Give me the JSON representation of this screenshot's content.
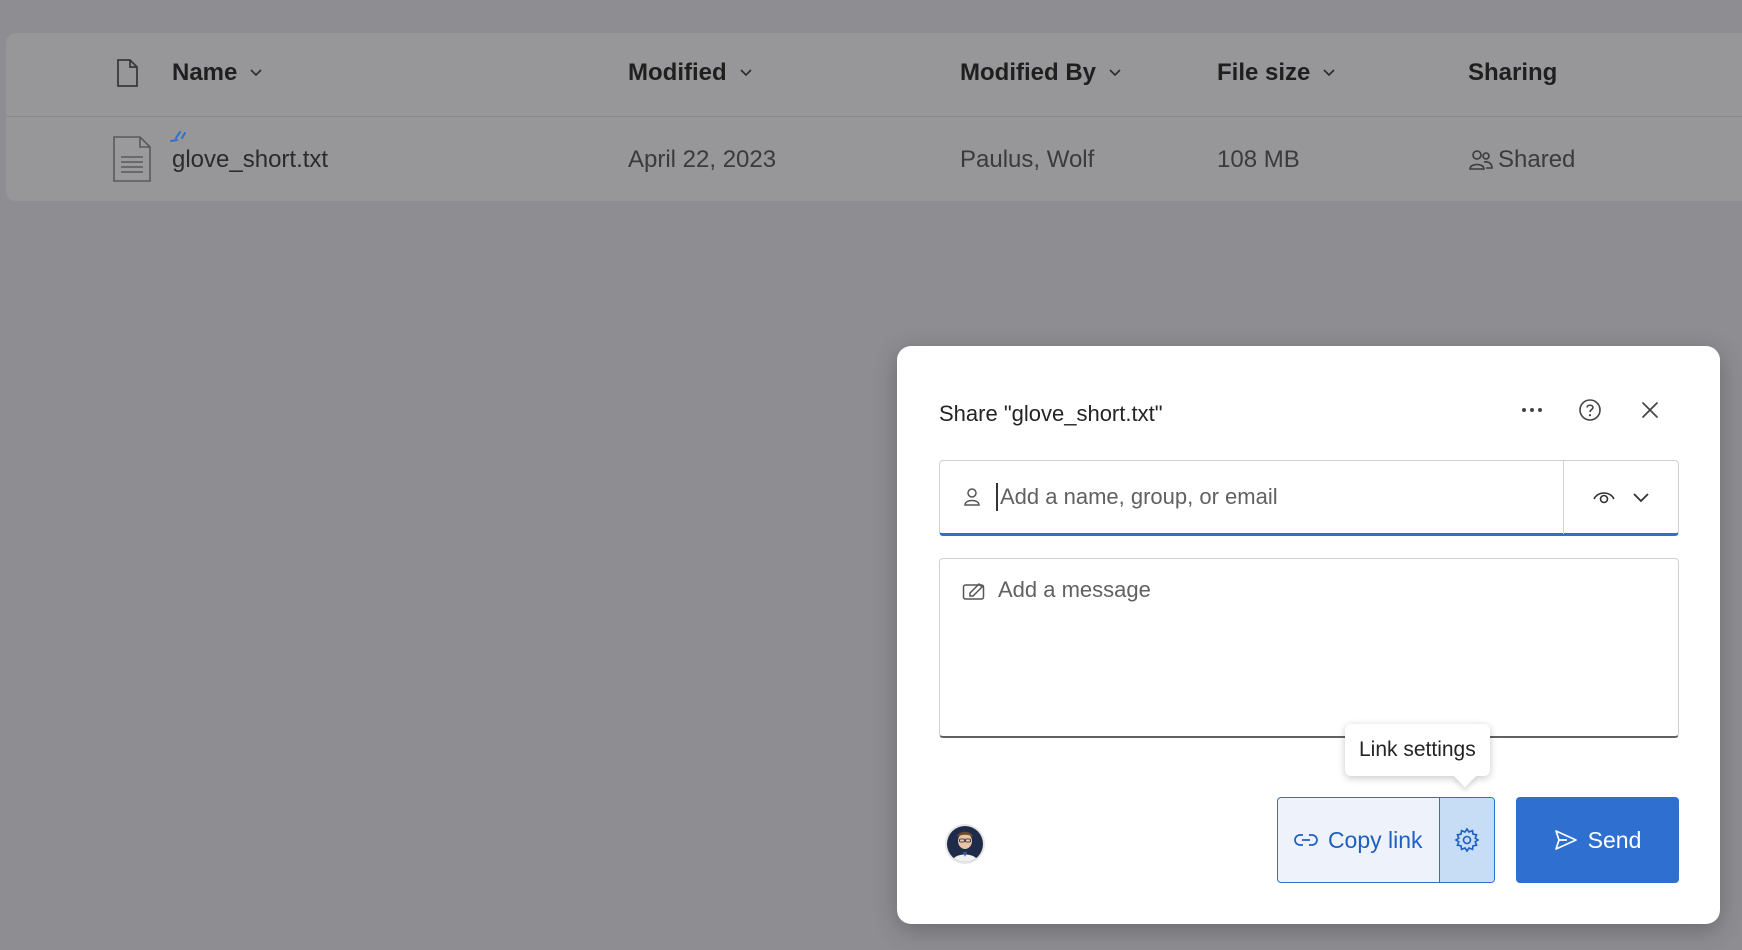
{
  "file_list": {
    "columns": [
      {
        "label": "Name",
        "sortable": true
      },
      {
        "label": "Modified",
        "sortable": true
      },
      {
        "label": "Modified By",
        "sortable": true
      },
      {
        "label": "File size",
        "sortable": true
      },
      {
        "label": "Sharing",
        "sortable": false
      }
    ],
    "rows": [
      {
        "name": "glove_short.txt",
        "modified": "April 22, 2023",
        "modified_by": "Paulus, Wolf",
        "file_size": "108 MB",
        "sharing": "Shared",
        "icon": "text-file-icon"
      }
    ]
  },
  "share_dialog": {
    "title": "Share \"glove_short.txt\"",
    "people_input": {
      "placeholder": "Add a name, group, or email",
      "value": ""
    },
    "permission_icon": "eye-icon",
    "message_input": {
      "placeholder": "Add a message",
      "value": ""
    },
    "tooltip": "Link settings",
    "copy_link_label": "Copy link",
    "send_label": "Send"
  },
  "colors": {
    "accent": "#2f6fd0",
    "overlay": "#8e8e92"
  }
}
